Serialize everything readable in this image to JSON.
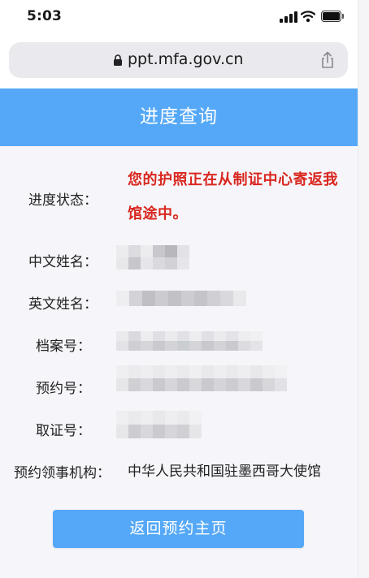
{
  "status_bar": {
    "time": "5:03"
  },
  "browser": {
    "url": "ppt.mfa.gov.cn"
  },
  "header": {
    "title": "进度查询"
  },
  "fields": [
    {
      "label": "进度状态：",
      "value": "您的护照正在从制证中心寄返我馆途中。"
    },
    {
      "label": "中文姓名：",
      "value": ""
    },
    {
      "label": "英文姓名：",
      "value": ""
    },
    {
      "label": "档案号：",
      "value": ""
    },
    {
      "label": "预约号：",
      "value": ""
    },
    {
      "label": "取证号：",
      "value": ""
    },
    {
      "label": "预约领事机构：",
      "value": "中华人民共和国驻墨西哥大使馆"
    }
  ],
  "colors": {
    "accent": "#55a8f7",
    "status_text": "#d9271f",
    "background": "#f6f6fa"
  },
  "button": {
    "back_label": "返回预约主页"
  },
  "icons": [
    "signal-icon",
    "wifi-icon",
    "battery-icon",
    "lock-icon",
    "share-icon"
  ]
}
